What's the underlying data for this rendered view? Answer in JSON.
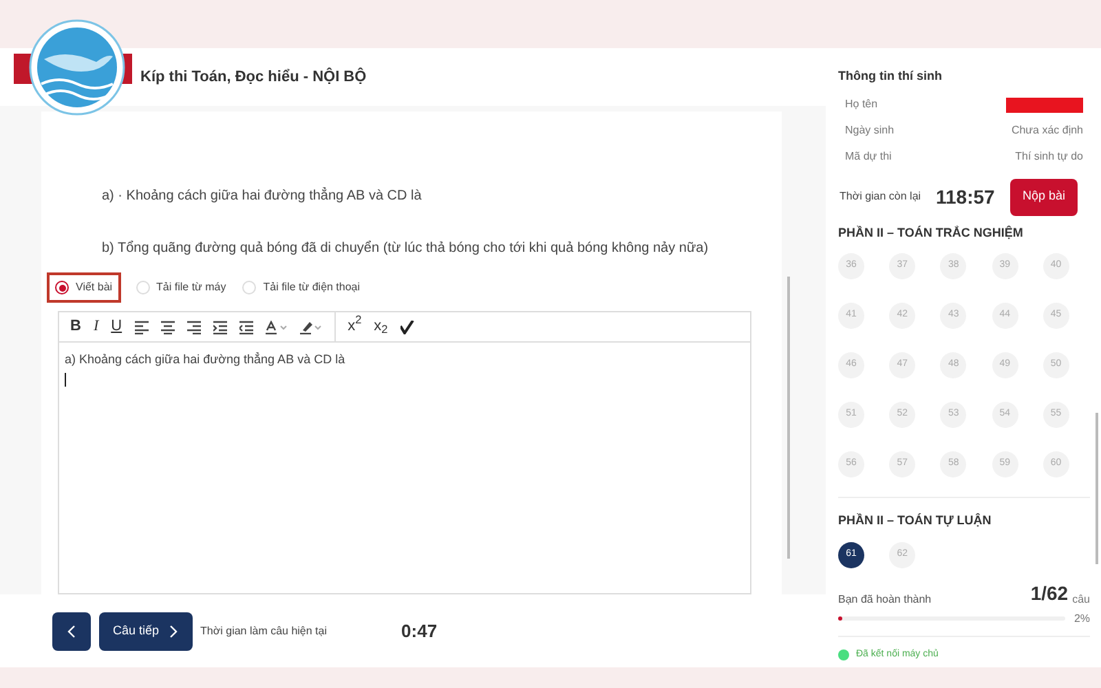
{
  "header": {
    "title": "Kíp thi Toán, Đọc hiểu - NỘI BỘ"
  },
  "question": {
    "lines": [
      "a) · Khoảng cách giữa hai đường thẳng AB và CD là",
      "b) Tổng quãng đường quả bóng đã di chuyển (từ lúc thả bóng cho tới khi quả bóng không nảy nữa)"
    ]
  },
  "answer_modes": [
    {
      "label": "Viết bài",
      "selected": true
    },
    {
      "label": "Tải file từ máy",
      "selected": false
    },
    {
      "label": "Tải file từ điện thoại",
      "selected": false
    }
  ],
  "toolbar": [
    {
      "label": "B"
    },
    {
      "label": "I"
    },
    {
      "label": "U"
    }
  ],
  "toolbar_scripts": [
    "x$^{2}$",
    "x$_{2}$"
  ],
  "editor": {
    "value": "a) Khoảng cách giữa hai đường thẳng AB và CD là"
  },
  "footer": {
    "next_label": "Câu tiếp",
    "timer_label": "Thời gian làm câu hiện tại",
    "timer": "0:47"
  },
  "candidate": {
    "title": "Thông tin thí sinh",
    "rows": [
      {
        "label": "Họ tên",
        "redacted": true
      },
      {
        "label": "Ngày sinh",
        "value": "Chưa xác định"
      },
      {
        "label": "Mã dự thi",
        "value": "Thí sinh tự do"
      }
    ]
  },
  "time_left": {
    "label": "Thời gian còn lại",
    "value": "118:57",
    "submit": "Nộp bài"
  },
  "sections": [
    {
      "title": "PHẦN II – TOÁN TRẮC NGHIỆM",
      "questions": [
        {
          "number": "36",
          "selected": false
        },
        {
          "number": "37",
          "selected": false
        },
        {
          "number": "38",
          "selected": false
        },
        {
          "number": "39",
          "selected": false
        },
        {
          "number": "40",
          "selected": false
        },
        {
          "number": "41",
          "selected": false
        },
        {
          "number": "42",
          "selected": false
        },
        {
          "number": "43",
          "selected": false
        },
        {
          "number": "44",
          "selected": false
        },
        {
          "number": "45",
          "selected": false
        },
        {
          "number": "46",
          "selected": false
        },
        {
          "number": "47",
          "selected": false
        },
        {
          "number": "48",
          "selected": false
        },
        {
          "number": "49",
          "selected": false
        },
        {
          "number": "50",
          "selected": false
        },
        {
          "number": "51",
          "selected": false
        },
        {
          "number": "52",
          "selected": false
        },
        {
          "number": "53",
          "selected": false
        },
        {
          "number": "54",
          "selected": false
        },
        {
          "number": "55",
          "selected": false
        },
        {
          "number": "56",
          "selected": false
        },
        {
          "number": "57",
          "selected": false
        },
        {
          "number": "58",
          "selected": false
        },
        {
          "number": "59",
          "selected": false
        },
        {
          "number": "60",
          "selected": false
        }
      ]
    },
    {
      "title": "PHẦN II – TOÁN TỰ LUẬN",
      "questions": [
        {
          "number": "61",
          "selected": true
        },
        {
          "number": "62",
          "selected": false
        }
      ]
    }
  ],
  "progress": {
    "label": "Bạn đã hoàn thành",
    "count": "1/62",
    "unit": "câu",
    "level": 0.02,
    "percent": "2%"
  },
  "connection": {
    "text": "Đã kết nối máy chủ",
    "color": "#4ade80"
  }
}
